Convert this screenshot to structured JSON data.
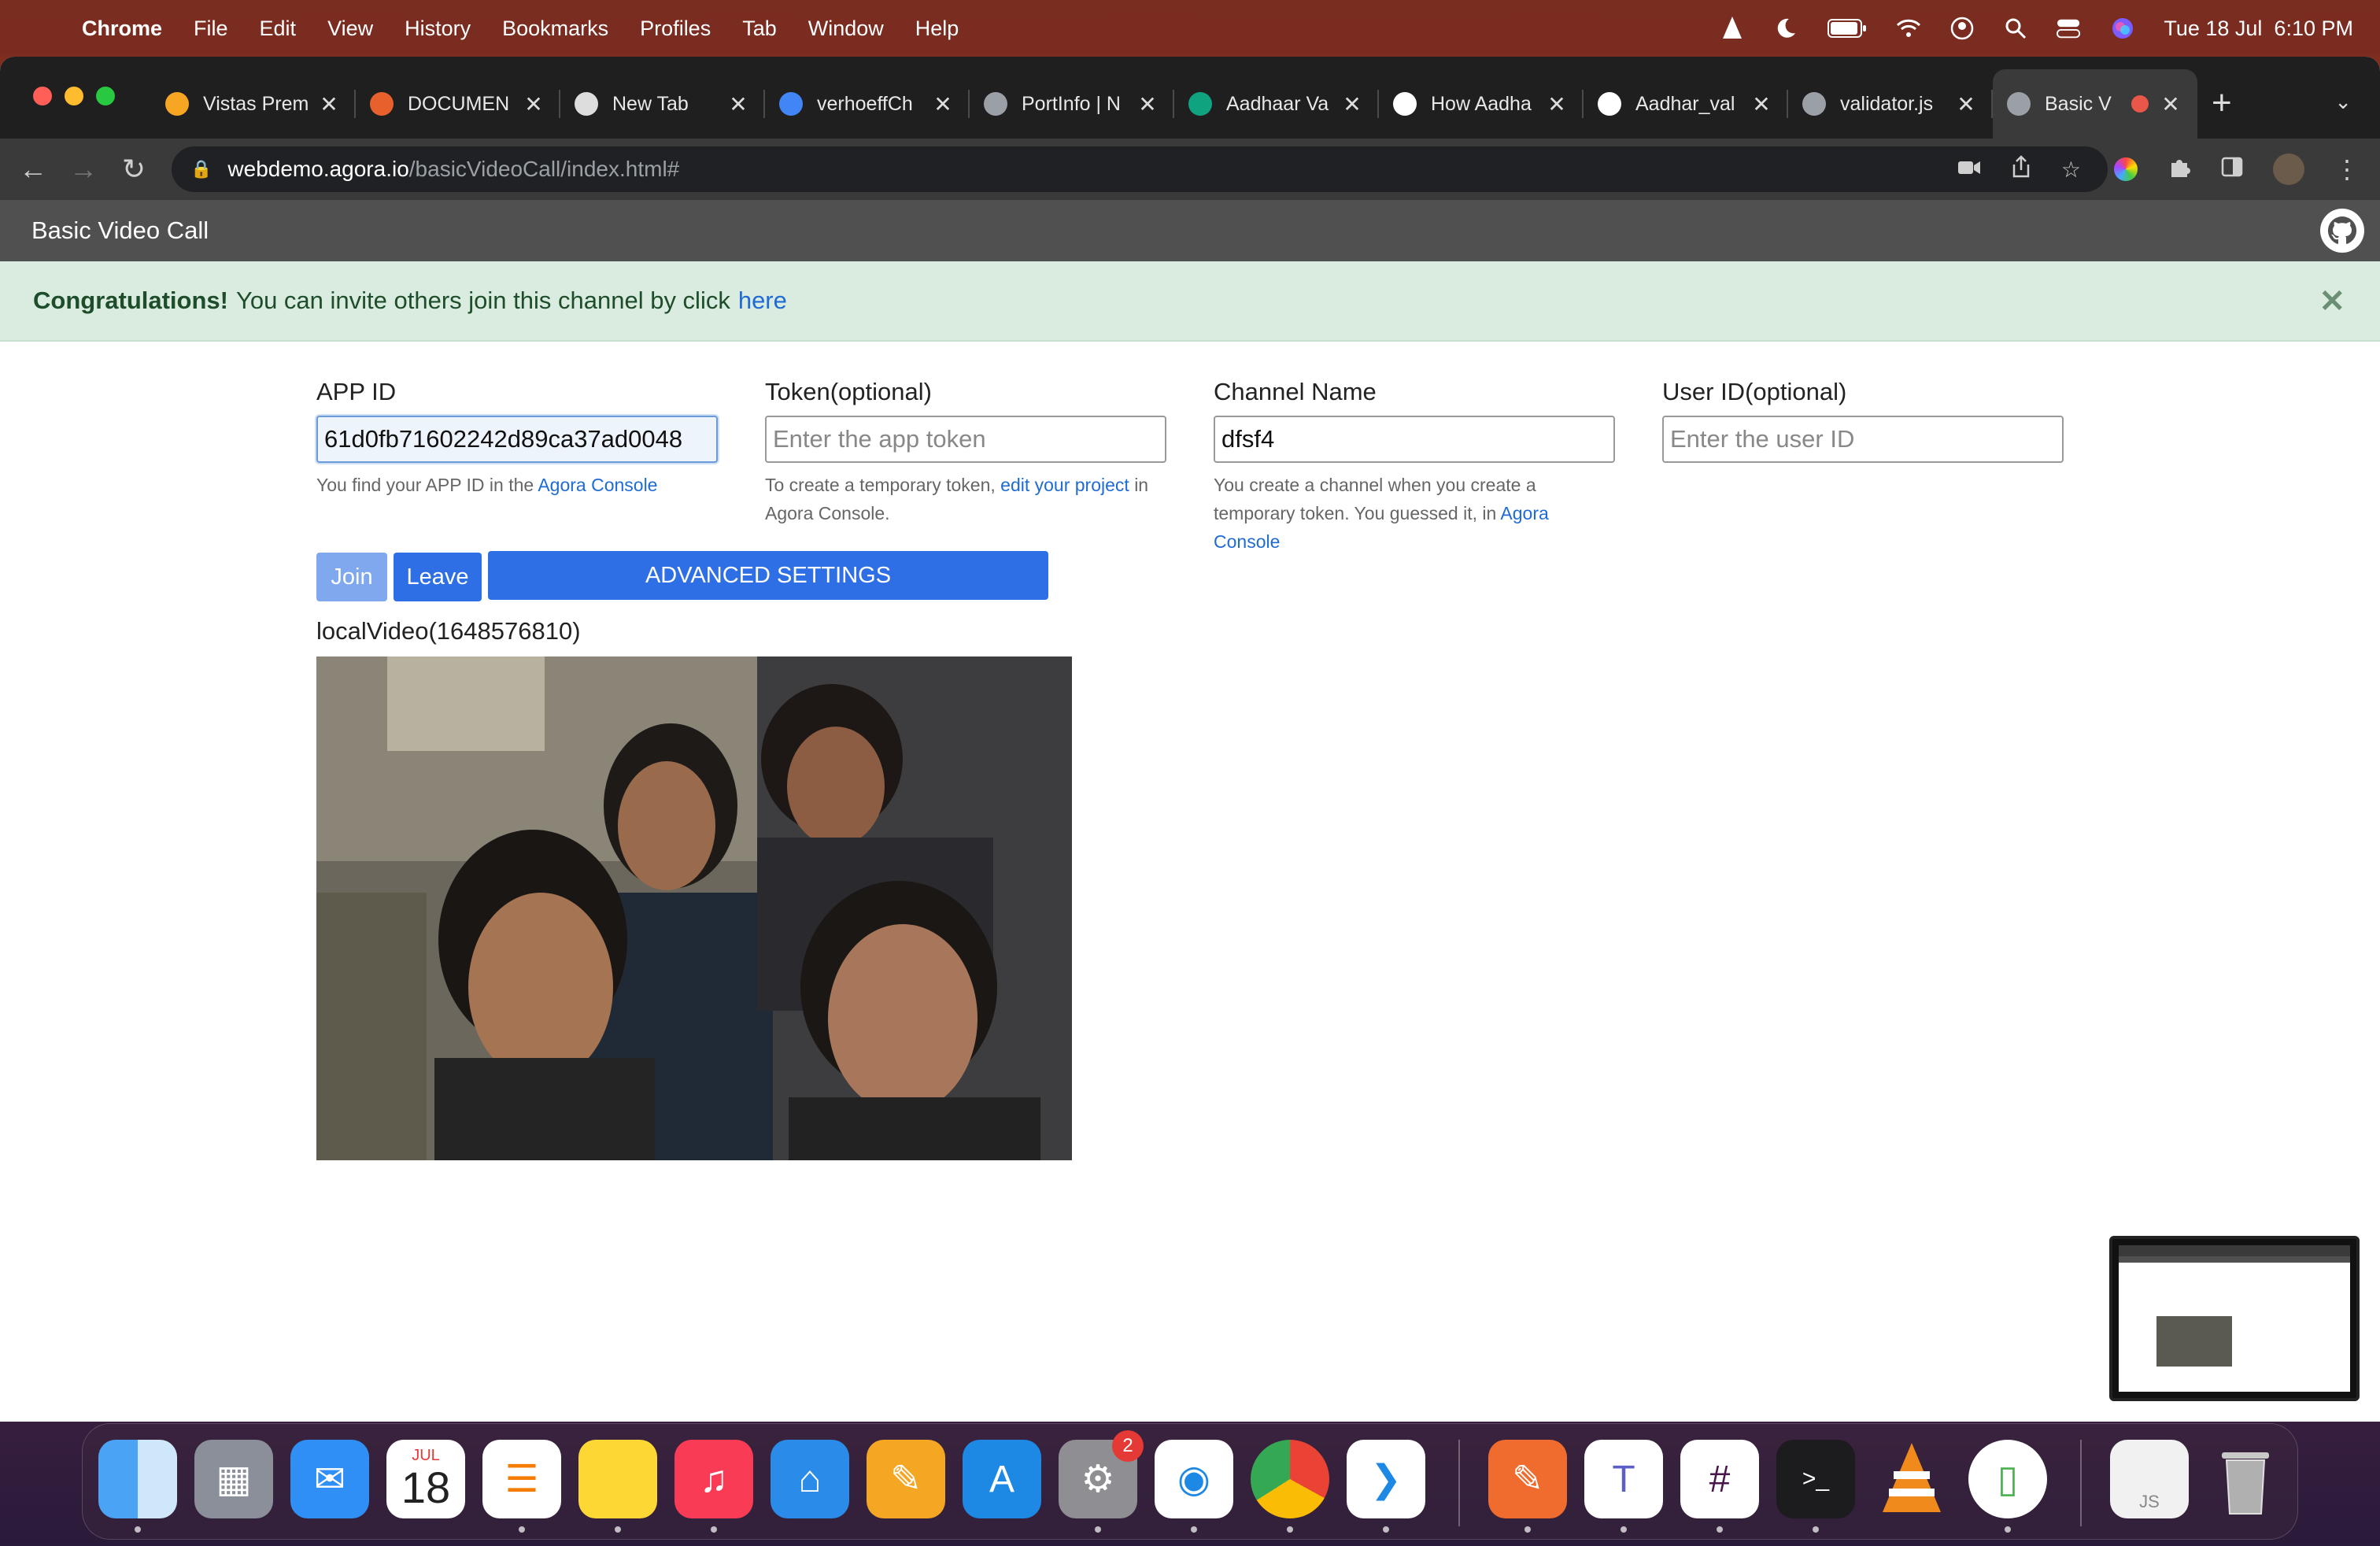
{
  "menubar": {
    "app": "Chrome",
    "items": [
      "File",
      "Edit",
      "View",
      "History",
      "Bookmarks",
      "Profiles",
      "Tab",
      "Window",
      "Help"
    ],
    "clock": "Tue 18 Jul  6:10 PM"
  },
  "tabs": [
    {
      "title": "Vistas Prem",
      "favicon_color": "#f6a623"
    },
    {
      "title": "DOCUMEN",
      "favicon_color": "#e8602c"
    },
    {
      "title": "New Tab",
      "favicon_color": "#dddddd"
    },
    {
      "title": "verhoeffCh",
      "favicon_color": "#4285f4"
    },
    {
      "title": "PortInfo | N",
      "favicon_color": "#9aa0a6"
    },
    {
      "title": "Aadhaar Va",
      "favicon_color": "#10a37f"
    },
    {
      "title": "How Aadha",
      "favicon_color": "#ffffff"
    },
    {
      "title": "Aadhar_val",
      "favicon_color": "#ffffff"
    },
    {
      "title": "validator.js",
      "favicon_color": "#9aa0a6"
    },
    {
      "title": "Basic V",
      "favicon_color": "#9aa0a6",
      "active": true
    }
  ],
  "address": {
    "host": "webdemo.agora.io",
    "path": "/basicVideoCall/index.html#"
  },
  "page": {
    "title": "Basic Video Call",
    "alert": {
      "strong": "Congratulations!",
      "text": "You can invite others join this channel by click",
      "link": "here"
    },
    "fields": {
      "appid": {
        "label": "APP ID",
        "value": "61d0fb71602242d89ca37ad0048",
        "help": "You find your APP ID in the",
        "help_link": "Agora Console"
      },
      "token": {
        "label": "Token(optional)",
        "placeholder": "Enter the app token",
        "help_pre": "To create a temporary token,",
        "help_link": "edit your project",
        "help_post": "in Agora Console."
      },
      "channel": {
        "label": "Channel Name",
        "value": "dfsf4",
        "help": "You create a channel when you create a temporary token. You guessed it, in",
        "help_link": "Agora Console"
      },
      "uid": {
        "label": "User ID(optional)",
        "placeholder": "Enter the user ID"
      }
    },
    "buttons": {
      "join": "Join",
      "leave": "Leave",
      "advanced": "ADVANCED SETTINGS"
    },
    "local_video_label": "localVideo(1648576810)"
  },
  "dock": {
    "calendar_month": "JUL",
    "calendar_day": "18",
    "settings_badge": "2"
  },
  "colors": {
    "primary": "#2f6fe6",
    "join_disabled": "#7fa8ee",
    "alert_bg": "#d9ecdf",
    "appbar": "#505050"
  }
}
